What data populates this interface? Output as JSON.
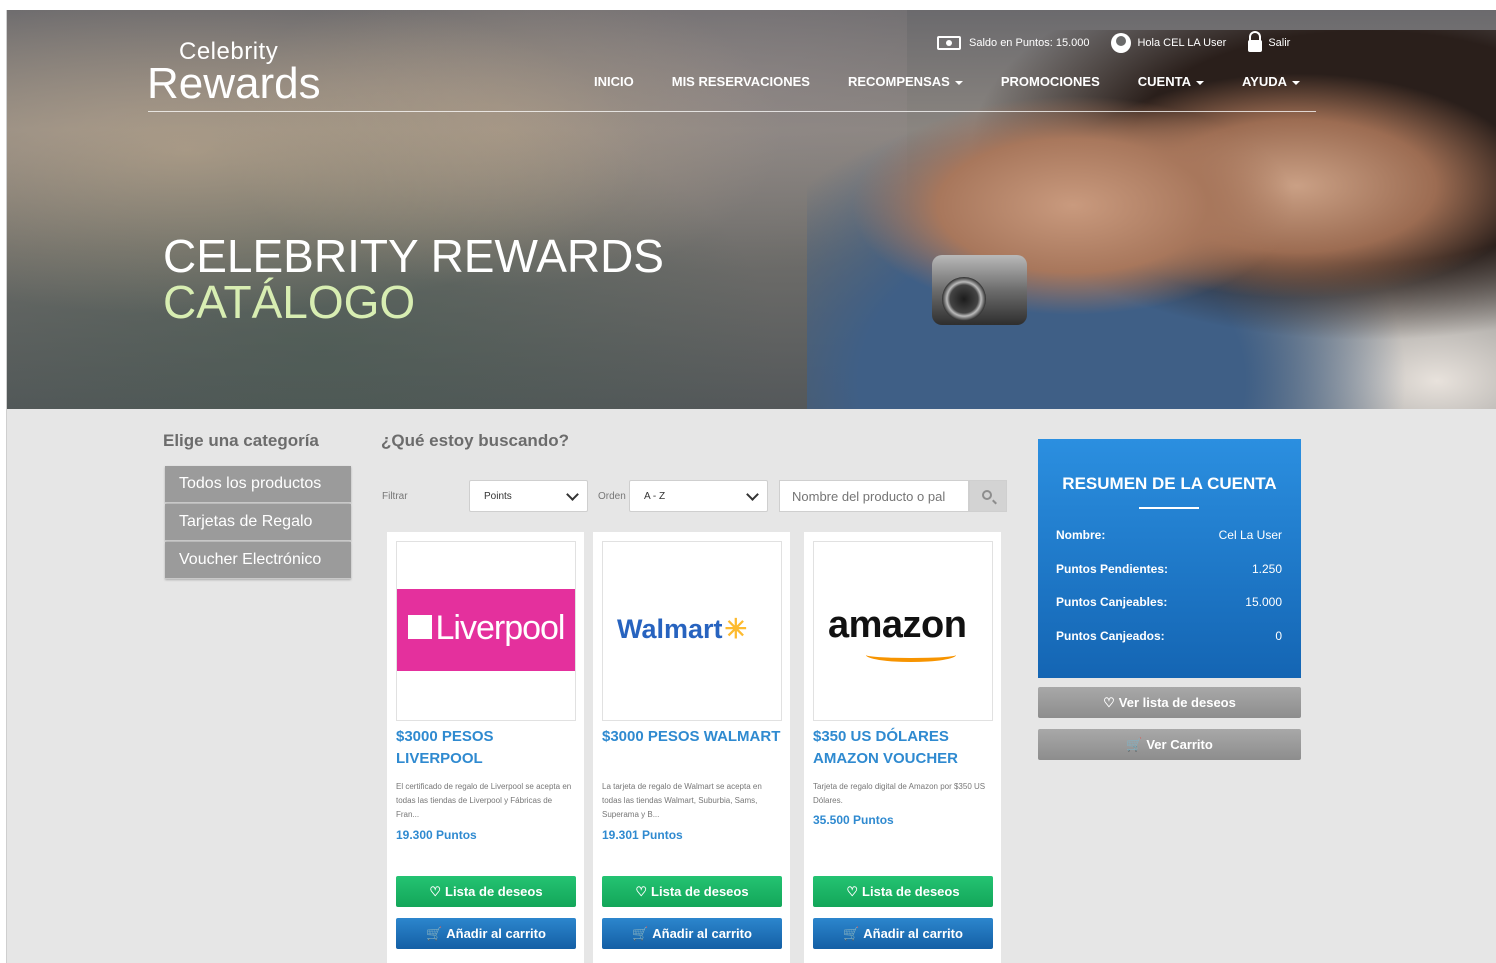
{
  "brand": {
    "line1": "Celebrity",
    "line2": "Rewards"
  },
  "topbar": {
    "balance": "Saldo en Puntos: 15.000",
    "greeting": "Hola CEL LA User",
    "logout": "Salir"
  },
  "nav": [
    {
      "label": "INICIO",
      "dropdown": false
    },
    {
      "label": "MIS RESERVACIONES",
      "dropdown": false
    },
    {
      "label": "RECOMPENSAS",
      "dropdown": true
    },
    {
      "label": "PROMOCIONES",
      "dropdown": false
    },
    {
      "label": "CUENTA",
      "dropdown": true
    },
    {
      "label": "AYUDA",
      "dropdown": true
    }
  ],
  "hero": {
    "title": "CELEBRITY REWARDS",
    "subtitle": "CATÁLOGO"
  },
  "categories": {
    "title": "Elige una categoría",
    "items": [
      "Todos los productos",
      "Tarjetas de Regalo",
      "Voucher Electrónico"
    ]
  },
  "search": {
    "title": "¿Qué estoy buscando?",
    "filter_label": "Filtrar",
    "filter_value": "Points",
    "order_label": "Orden",
    "order_value": "A - Z",
    "placeholder": "Nombre del producto o pal"
  },
  "products": [
    {
      "title": "$3000 PESOS LIVERPOOL",
      "description": "El certificado de regalo de Liverpool se acepta en todas las tiendas de Liverpool y Fábricas de Fran...",
      "points": "19.300 Puntos",
      "logo": "Liverpool",
      "wishlist": "Lista de deseos",
      "cart": "Añadir al carrito"
    },
    {
      "title": "$3000 PESOS WALMART",
      "description": "La tarjeta de regalo de Walmart se acepta en todas las tiendas Walmart, Suburbia, Sams, Superama y B...",
      "points": "19.301 Puntos",
      "logo": "Walmart",
      "wishlist": "Lista de deseos",
      "cart": "Añadir al carrito"
    },
    {
      "title": "$350 US DÓLARES AMAZON VOUCHER",
      "description": "Tarjeta de regalo digital de Amazon por $350 US Dólares.",
      "points": "35.500 Puntos",
      "logo": "amazon",
      "wishlist": "Lista de deseos",
      "cart": "Añadir al carrito"
    }
  ],
  "summary": {
    "title": "RESUMEN DE LA CUENTA",
    "rows": [
      {
        "label": "Nombre:",
        "value": "Cel La User"
      },
      {
        "label": "Puntos Pendientes:",
        "value": "1.250"
      },
      {
        "label": "Puntos Canjeables:",
        "value": "15.000"
      },
      {
        "label": "Puntos Canjeados:",
        "value": "0"
      }
    ],
    "wishlist_button": "Ver lista de deseos",
    "cart_button": "Ver Carrito"
  },
  "colors": {
    "accent_blue": "#2f8ad0",
    "summary_blue": "#1e78c8",
    "green": "#1bb566",
    "hero_subtitle": "#d8eeb2"
  },
  "icons": [
    "cash-icon",
    "user-circle-icon",
    "unlock-icon",
    "search-icon",
    "heart-icon",
    "cart-icon",
    "chevron-down-icon"
  ]
}
